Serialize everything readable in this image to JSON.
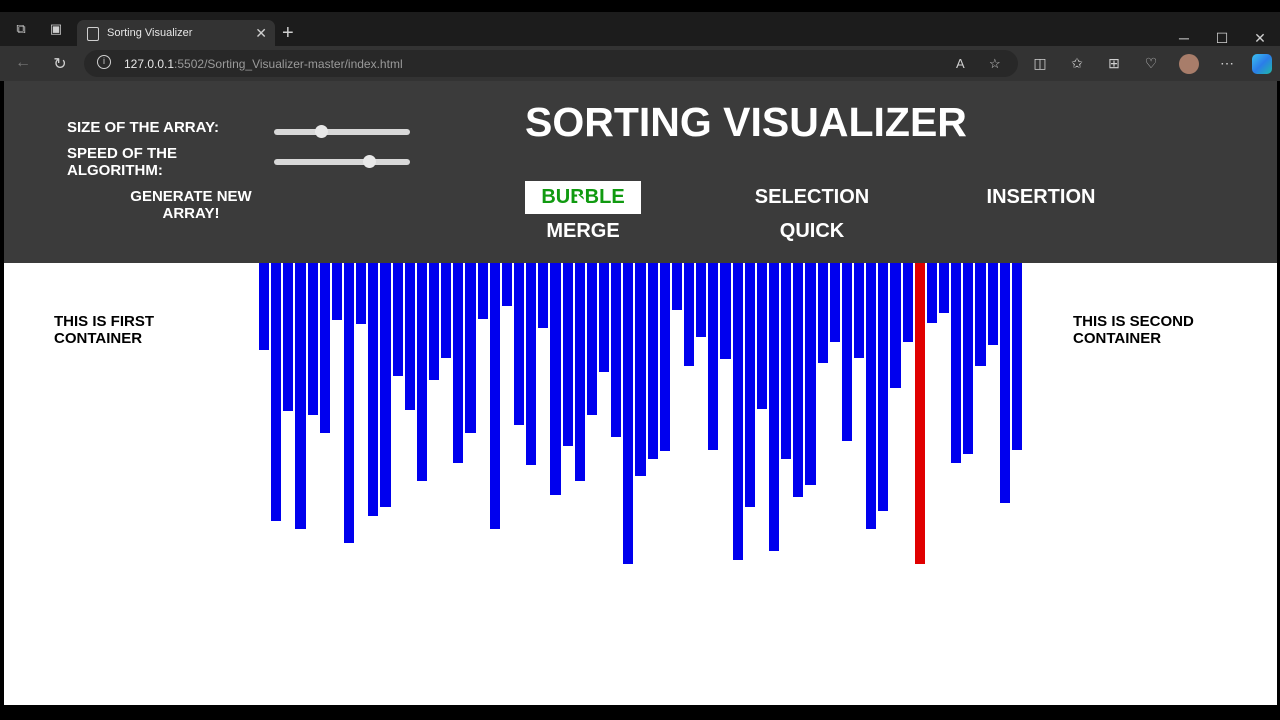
{
  "browser": {
    "tab_title": "Sorting Visualizer",
    "url_host": "127.0.0.1",
    "url_rest": ":5502/Sorting_Visualizer-master/index.html"
  },
  "app": {
    "title": "SORTING VISUALIZER",
    "size_label": "SIZE OF THE ARRAY:",
    "speed_label_1": "SPEED OF THE",
    "speed_label_2": "ALGORITHM:",
    "size_value": 0.33,
    "speed_value": 0.72,
    "generate_1": "GENERATE NEW",
    "generate_2": "ARRAY!",
    "algorithms": {
      "bubble": "BUBBLE",
      "selection": "SELECTION",
      "insertion": "INSERTION",
      "merge": "MERGE",
      "quick": "QUICK"
    },
    "active_algorithm": "BUBBLE",
    "first_container_1": "THIS IS FIRST",
    "first_container_2": "CONTAINER",
    "second_container_1": "THIS IS SECOND",
    "second_container_2": "CONTAINER"
  },
  "colors": {
    "bar": "#0000ee",
    "bar_active": "#e00000",
    "active_button_text": "#109a10"
  },
  "array": {
    "values": [
      87,
      258,
      148,
      266,
      152,
      170,
      57,
      280,
      61,
      253,
      244,
      113,
      147,
      218,
      117,
      95,
      200,
      170,
      56,
      266,
      43,
      162,
      202,
      65,
      232,
      183,
      218,
      152,
      109,
      174,
      301,
      213,
      196,
      188,
      47,
      103,
      74,
      187,
      96,
      297,
      244,
      146,
      288,
      196,
      234,
      222,
      100,
      79,
      178,
      95,
      266,
      248,
      125,
      79,
      301,
      60,
      50,
      200,
      191,
      103,
      82,
      240,
      187
    ],
    "active_index": 54
  }
}
